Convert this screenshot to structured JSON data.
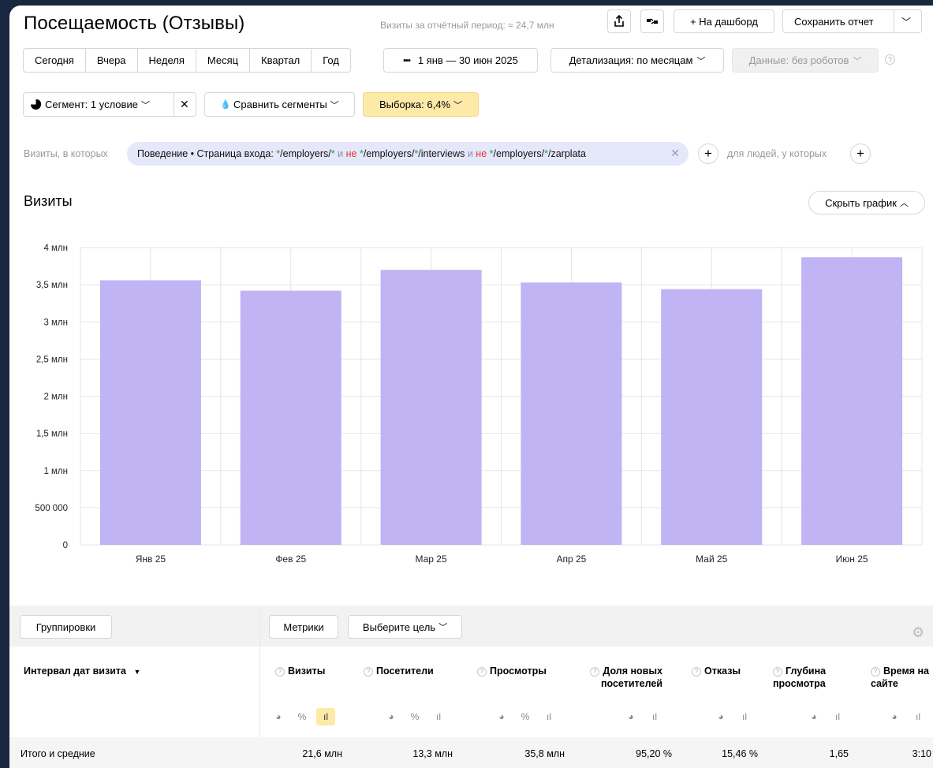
{
  "header": {
    "title": "Посещаемость (Отзывы)",
    "visits_period": "Визиты за отчётный период: ≈ 24,7 млн",
    "to_dashboard": "+ На дашборд",
    "save_report": "Сохранить отчет"
  },
  "periods": [
    "Сегодня",
    "Вчера",
    "Неделя",
    "Месяц",
    "Квартал",
    "Год"
  ],
  "date_range": "1 янв — 30 июн 2025",
  "detalization": "Детализация: по месяцам",
  "data_filter": "Данные: без роботов",
  "segment": "Сегмент: 1 условие",
  "compare_segments": "Сравнить сегменты",
  "sample": "Выборка: 6,4%",
  "filter": {
    "label": "Визиты, в которых",
    "chip_prefix": "Поведение • Страница входа: ",
    "part1": "/employers/",
    "and1": "и",
    "not1": "не",
    "part2": "/employers/",
    "part2b": "/interviews",
    "and2": "и",
    "not2": "не",
    "part3": "/employers/",
    "part3b": "/zarplata",
    "star": "*",
    "people_label": "для людей, у которых"
  },
  "chart_section": {
    "title": "Визиты",
    "hide_button": "Скрыть график"
  },
  "chart_data": {
    "type": "bar",
    "categories": [
      "Янв 25",
      "Фев 25",
      "Мар 25",
      "Апр 25",
      "Май 25",
      "Июн 25"
    ],
    "values": [
      3560000,
      3420000,
      3700000,
      3530000,
      3440000,
      3870000
    ],
    "ylim": [
      0,
      4000000
    ],
    "yticks": [
      0,
      500000,
      1000000,
      1500000,
      2000000,
      2500000,
      3000000,
      3500000,
      4000000
    ],
    "ytick_labels": [
      "0",
      "500 000",
      "1 млн",
      "1,5 млн",
      "2 млн",
      "2,5 млн",
      "3 млн",
      "3,5 млн",
      "4 млн"
    ],
    "grid": true,
    "bar_color": "#c0b4f4"
  },
  "table": {
    "groupings": "Группировки",
    "metrics": "Метрики",
    "goal": "Выберите цель",
    "dim_header": "Интервал дат визита",
    "columns": [
      {
        "label": "Визиты"
      },
      {
        "label": "Посетители"
      },
      {
        "label": "Просмотры"
      },
      {
        "label": "Доля новых посетителей"
      },
      {
        "label": "Отказы"
      },
      {
        "label": "Глубина просмотра"
      },
      {
        "label": "Время на сайте"
      }
    ],
    "total_label": "Итого и средние",
    "totals": [
      "21,6 млн",
      "13,3 млн",
      "35,8 млн",
      "95,20 %",
      "15,46 %",
      "1,65",
      "3:10"
    ]
  }
}
